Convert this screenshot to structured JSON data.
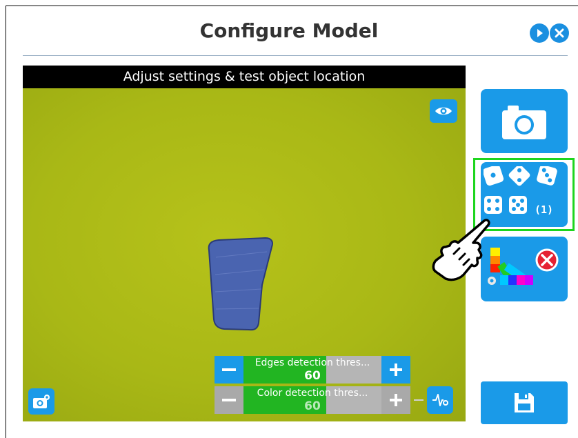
{
  "header": {
    "title": "Configure Model"
  },
  "viewer": {
    "caption": "Adjust settings & test object location"
  },
  "sliders": {
    "edges": {
      "label": "Edges detection thres...",
      "value": "60",
      "level_percent": 60
    },
    "color": {
      "label": "Color detection thres...",
      "value": "60",
      "level_percent": 60
    }
  },
  "sidebar": {
    "multi_view_count": "(1)"
  },
  "colors": {
    "accent": "#1a9ae8",
    "highlight": "#1ed51e",
    "slider_fill": "#22b522",
    "disabled": "#b5b5b5",
    "camera_background": "#a9b816",
    "object": "#4a64b0"
  },
  "icons": {
    "header": [
      "play-icon",
      "close-icon"
    ],
    "viewer": [
      "eye-icon",
      "camera-settings-icon",
      "signal-icon"
    ],
    "sidebar": [
      "camera-icon",
      "multi-view-icon",
      "color-palette-icon",
      "save-icon"
    ]
  }
}
